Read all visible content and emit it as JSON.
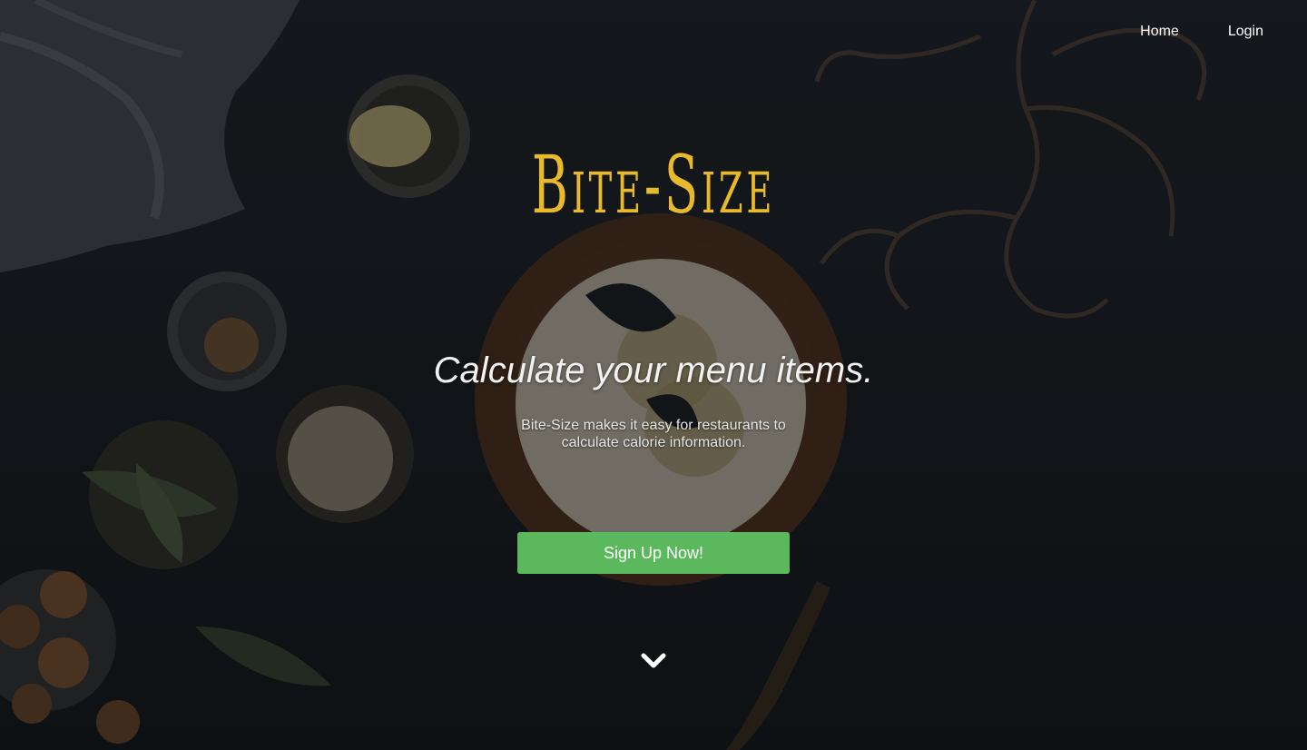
{
  "nav": {
    "items": [
      {
        "label": "Home"
      },
      {
        "label": "Login"
      }
    ]
  },
  "hero": {
    "brand": "Bite-Size",
    "headline": "Calculate your menu items.",
    "subtext": "Bite-Size makes it easy for restaurants to calculate calorie information.",
    "cta_label": "Sign Up Now!",
    "scroll_icon": "chevron-down-icon"
  },
  "colors": {
    "brand": "#e9b92c",
    "cta": "#5cb85c",
    "background": "#14181c",
    "text": "#ffffff"
  }
}
